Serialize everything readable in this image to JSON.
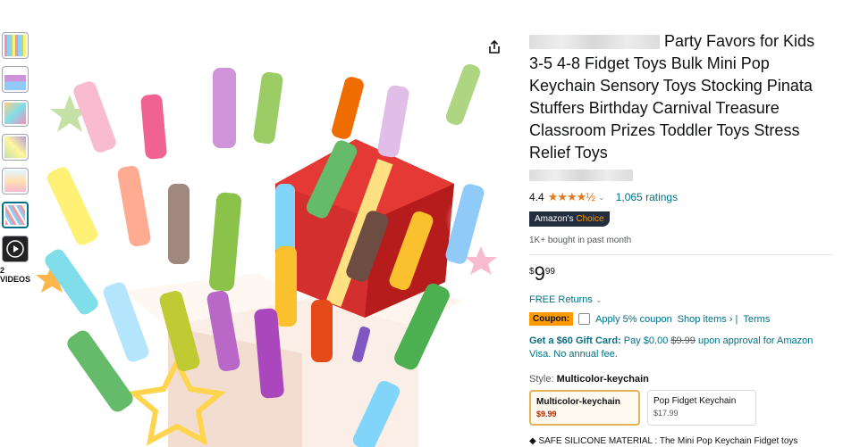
{
  "thumbnails": [
    {
      "name": "thumb-grid"
    },
    {
      "name": "thumb-package"
    },
    {
      "name": "thumb-hands"
    },
    {
      "name": "thumb-scene"
    },
    {
      "name": "thumb-kids"
    },
    {
      "name": "thumb-keychains"
    },
    {
      "name": "thumb-video"
    }
  ],
  "videos_label": "2 VIDEOS",
  "product": {
    "title_text": "Party Favors for Kids 3-5 4-8 Fidget Toys Bulk Mini Pop Keychain Sensory Toys Stocking Pinata Stuffers Birthday Carnival Treasure Classroom Prizes Toddler Toys Stress Relief Toys",
    "rating": "4.4",
    "stars": "★★★★½",
    "ratings_count": "1,065 ratings",
    "badge_prefix": "Amazon's",
    "badge_suffix": "Choice",
    "bought": "1K+ bought in past month",
    "price_symbol": "$",
    "price_whole": "9",
    "price_fraction": "99",
    "returns": "FREE Returns",
    "coupon_badge": "Coupon:",
    "coupon_text": "Apply 5% coupon",
    "shop_items": "Shop items › |",
    "terms": "Terms",
    "gift_bold": "Get a $60 Gift Card:",
    "gift_pay": "Pay",
    "gift_zero": "$0.00",
    "gift_strike": "$9.99",
    "gift_rest": "upon approval for Amazon Visa. No annual fee.",
    "style_prefix": "Style:",
    "style_value": "Multicolor-keychain",
    "options": [
      {
        "name": "Multicolor-keychain",
        "price": "$9.99"
      },
      {
        "name": "Pop Fidget Keychain",
        "price": "$17.99"
      }
    ],
    "bullet": "◆ SAFE SILICONE MATERIAL : The Mini Pop Keychain Fidget toys"
  },
  "colors": {
    "link": "#007185",
    "star": "#de7921",
    "coupon": "#ff9900",
    "badge": "#232f3e"
  }
}
